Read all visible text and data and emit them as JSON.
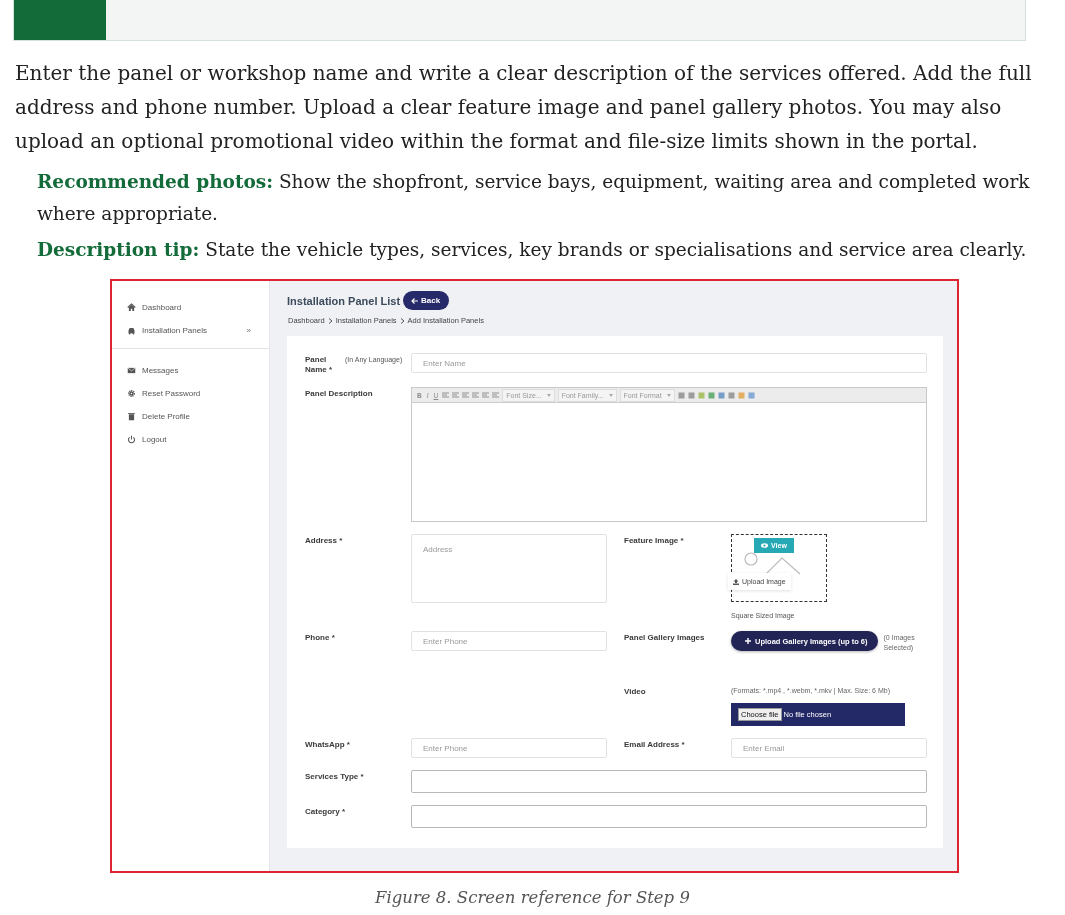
{
  "intro": "Enter the panel or workshop name and write a clear description of the services offered. Add the full address and phone number. Upload a clear feature image and panel gallery photos. You may also upload an optional promotional video within the format and file-size limits shown in the portal.",
  "tips": [
    {
      "label": "Recommended photos:",
      "text": "Show the shopfront, service bays, equipment, waiting area and completed work where appropriate."
    },
    {
      "label": "Description tip:",
      "text": "State the vehicle types, services, key brands or specialisations and service area clearly."
    }
  ],
  "screenshot": {
    "sidebar": {
      "groups": [
        [
          {
            "label": "Dashboard"
          },
          {
            "label": "Installation Panels",
            "expander": "»"
          }
        ],
        [
          {
            "label": "Messages"
          },
          {
            "label": "Reset Password"
          },
          {
            "label": "Delete Profile"
          },
          {
            "label": "Logout"
          }
        ]
      ]
    },
    "page_title": "Installation Panel List",
    "back_button": "Back",
    "breadcrumb": [
      "Dashboard",
      "Installation Panels",
      "Add Installation Panels"
    ],
    "form_rows": [
      {
        "full": {
          "label": "Panel Name *",
          "note": "(In Any Language)",
          "kind": "input",
          "placeholder": "Enter Name"
        }
      },
      {
        "full": {
          "label": "Panel Description",
          "kind": "editor",
          "toolbar_buttons": [
            "B",
            "I",
            "U"
          ],
          "dropdowns": [
            "Font Size...",
            "Font Family...",
            "Font Format"
          ]
        }
      },
      {
        "left": {
          "label": "Address *",
          "kind": "textarea",
          "placeholder": "Address"
        },
        "right": {
          "label": "Feature Image *",
          "kind": "image-upload",
          "view_button": "View",
          "upload_button": "Upload Image",
          "hint": "Square Sized Image"
        }
      },
      {
        "left": {
          "label": "Phone *",
          "kind": "input",
          "placeholder": "Enter Phone"
        },
        "right": {
          "label": "Panel Gallery Images",
          "kind": "gallery-upload",
          "button": "Upload Gallery Images (up to 6)",
          "count": "(0 Images Selected)"
        }
      },
      {
        "right": {
          "label": "Video",
          "kind": "file",
          "hint": "(Formats: *.mp4 , *.webm, *.mkv | Max. Size: 6 Mb)",
          "choose_button": "Choose file",
          "status": "No file chosen"
        }
      },
      {
        "left": {
          "label": "WhatsApp *",
          "kind": "input",
          "placeholder": "Enter Phone"
        },
        "right": {
          "label": "Email Address *",
          "kind": "input",
          "placeholder": "Enter Email"
        }
      },
      {
        "full": {
          "label": "Services Type *",
          "kind": "select"
        }
      },
      {
        "full": {
          "label": "Category *",
          "kind": "select"
        }
      }
    ]
  },
  "caption": "Figure 8. Screen reference for Step 9"
}
